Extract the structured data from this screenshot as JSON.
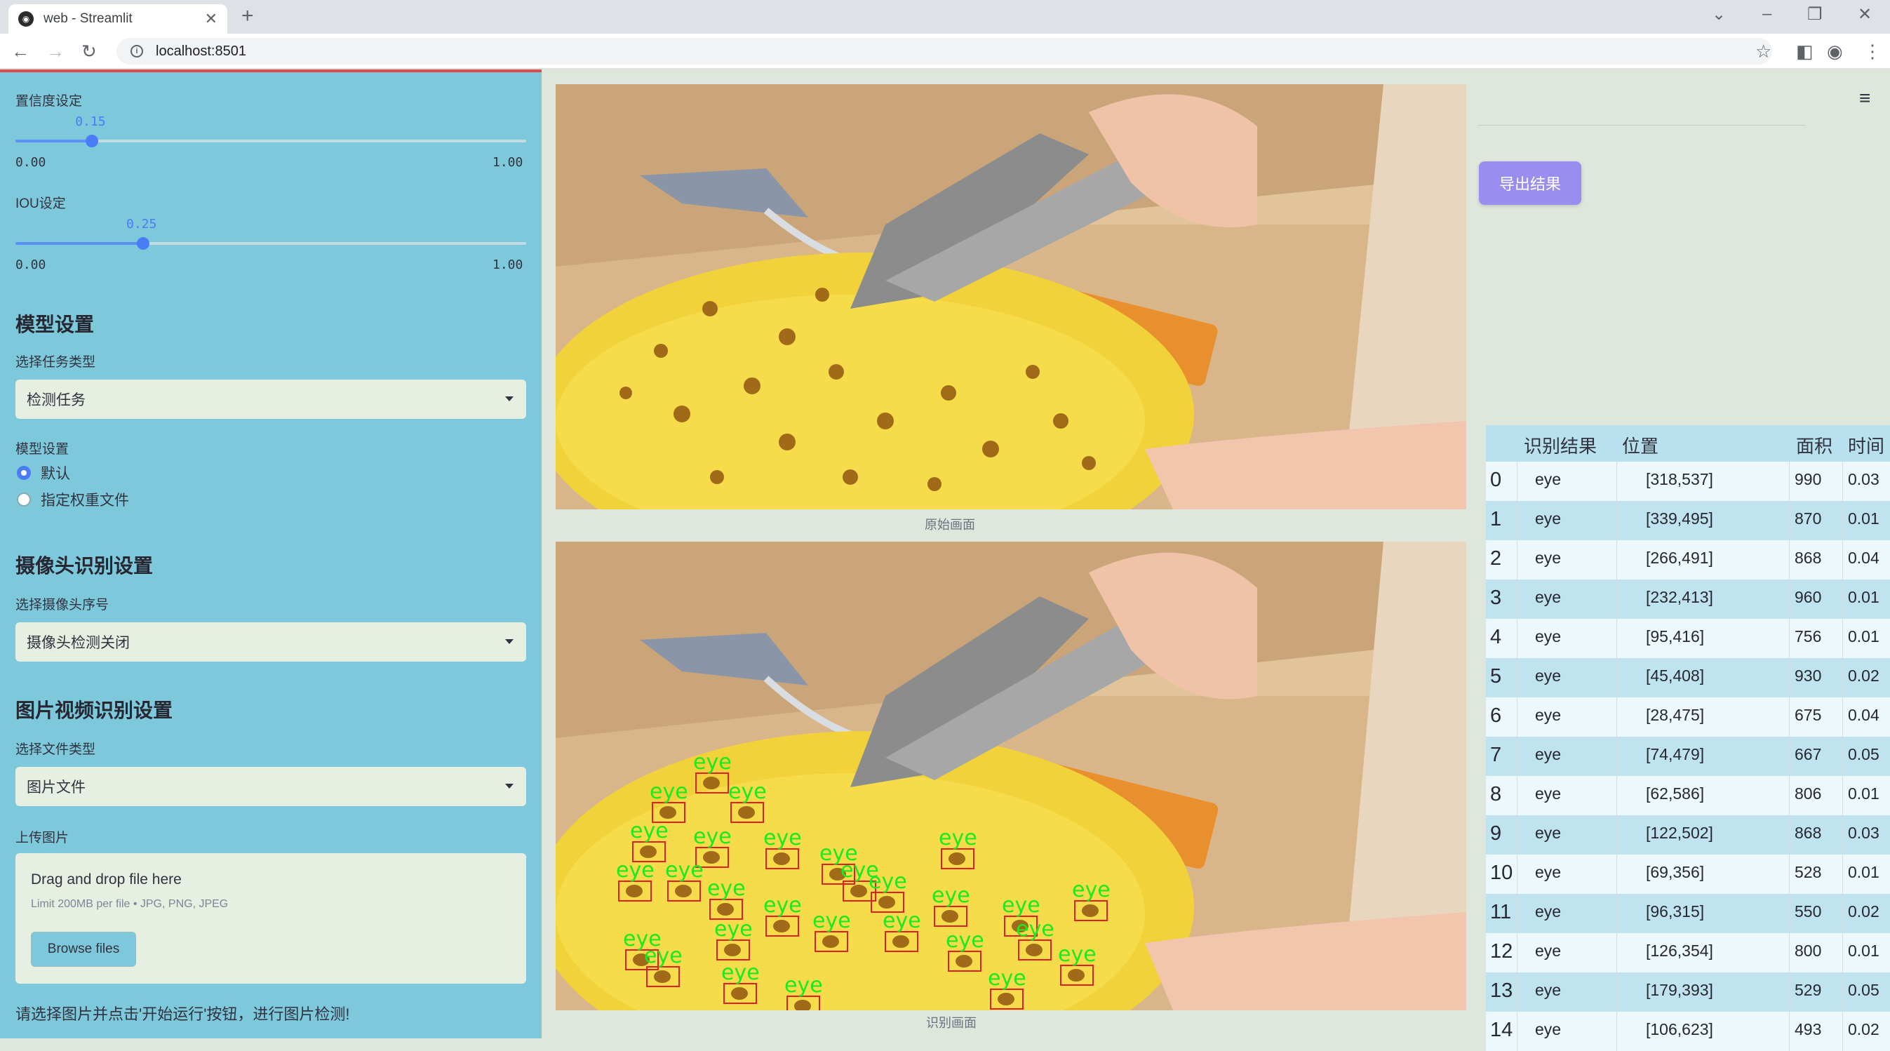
{
  "browser": {
    "tab_title": "web - Streamlit",
    "url": "localhost:8501"
  },
  "sidebar": {
    "confidence": {
      "label": "置信度设定",
      "value": "0.15",
      "min": "0.00",
      "max": "1.00",
      "fraction": 0.15
    },
    "iou": {
      "label": "IOU设定",
      "value": "0.25",
      "min": "0.00",
      "max": "1.00",
      "fraction": 0.25
    },
    "model_heading": "模型设置",
    "task_label": "选择任务类型",
    "task_value": "检测任务",
    "model_label": "模型设置",
    "model_options": [
      "默认",
      "指定权重文件"
    ],
    "model_selected": 0,
    "camera_heading": "摄像头识别设置",
    "camera_label": "选择摄像头序号",
    "camera_value": "摄像头检测关闭",
    "media_heading": "图片视频识别设置",
    "file_type_label": "选择文件类型",
    "file_type_value": "图片文件",
    "upload_label": "上传图片",
    "upload_title": "Drag and drop file here",
    "upload_limit": "Limit 200MB per file • JPG, PNG, JPEG",
    "browse_label": "Browse files",
    "note": "请选择图片并点击'开始运行'按钮，进行图片检测!"
  },
  "main": {
    "caption_original": "原始画面",
    "caption_detected": "识别画面",
    "export_label": "导出结果",
    "detection_label": "eye"
  },
  "table": {
    "headers": [
      "识别结果",
      "位置",
      "面积",
      "时间"
    ],
    "rows": [
      {
        "idx": "0",
        "result": "eye",
        "pos": "[318,537]",
        "area": "990",
        "time": "0.03"
      },
      {
        "idx": "1",
        "result": "eye",
        "pos": "[339,495]",
        "area": "870",
        "time": "0.01"
      },
      {
        "idx": "2",
        "result": "eye",
        "pos": "[266,491]",
        "area": "868",
        "time": "0.04"
      },
      {
        "idx": "3",
        "result": "eye",
        "pos": "[232,413]",
        "area": "960",
        "time": "0.01"
      },
      {
        "idx": "4",
        "result": "eye",
        "pos": "[95,416]",
        "area": "756",
        "time": "0.01"
      },
      {
        "idx": "5",
        "result": "eye",
        "pos": "[45,408]",
        "area": "930",
        "time": "0.02"
      },
      {
        "idx": "6",
        "result": "eye",
        "pos": "[28,475]",
        "area": "675",
        "time": "0.04"
      },
      {
        "idx": "7",
        "result": "eye",
        "pos": "[74,479]",
        "area": "667",
        "time": "0.05"
      },
      {
        "idx": "8",
        "result": "eye",
        "pos": "[62,586]",
        "area": "806",
        "time": "0.01"
      },
      {
        "idx": "9",
        "result": "eye",
        "pos": "[122,502]",
        "area": "868",
        "time": "0.03"
      },
      {
        "idx": "10",
        "result": "eye",
        "pos": "[69,356]",
        "area": "528",
        "time": "0.01"
      },
      {
        "idx": "11",
        "result": "eye",
        "pos": "[96,315]",
        "area": "550",
        "time": "0.02"
      },
      {
        "idx": "12",
        "result": "eye",
        "pos": "[126,354]",
        "area": "800",
        "time": "0.01"
      },
      {
        "idx": "13",
        "result": "eye",
        "pos": "[179,393]",
        "area": "529",
        "time": "0.05"
      },
      {
        "idx": "14",
        "result": "eye",
        "pos": "[106,623]",
        "area": "493",
        "time": "0.02"
      }
    ]
  }
}
